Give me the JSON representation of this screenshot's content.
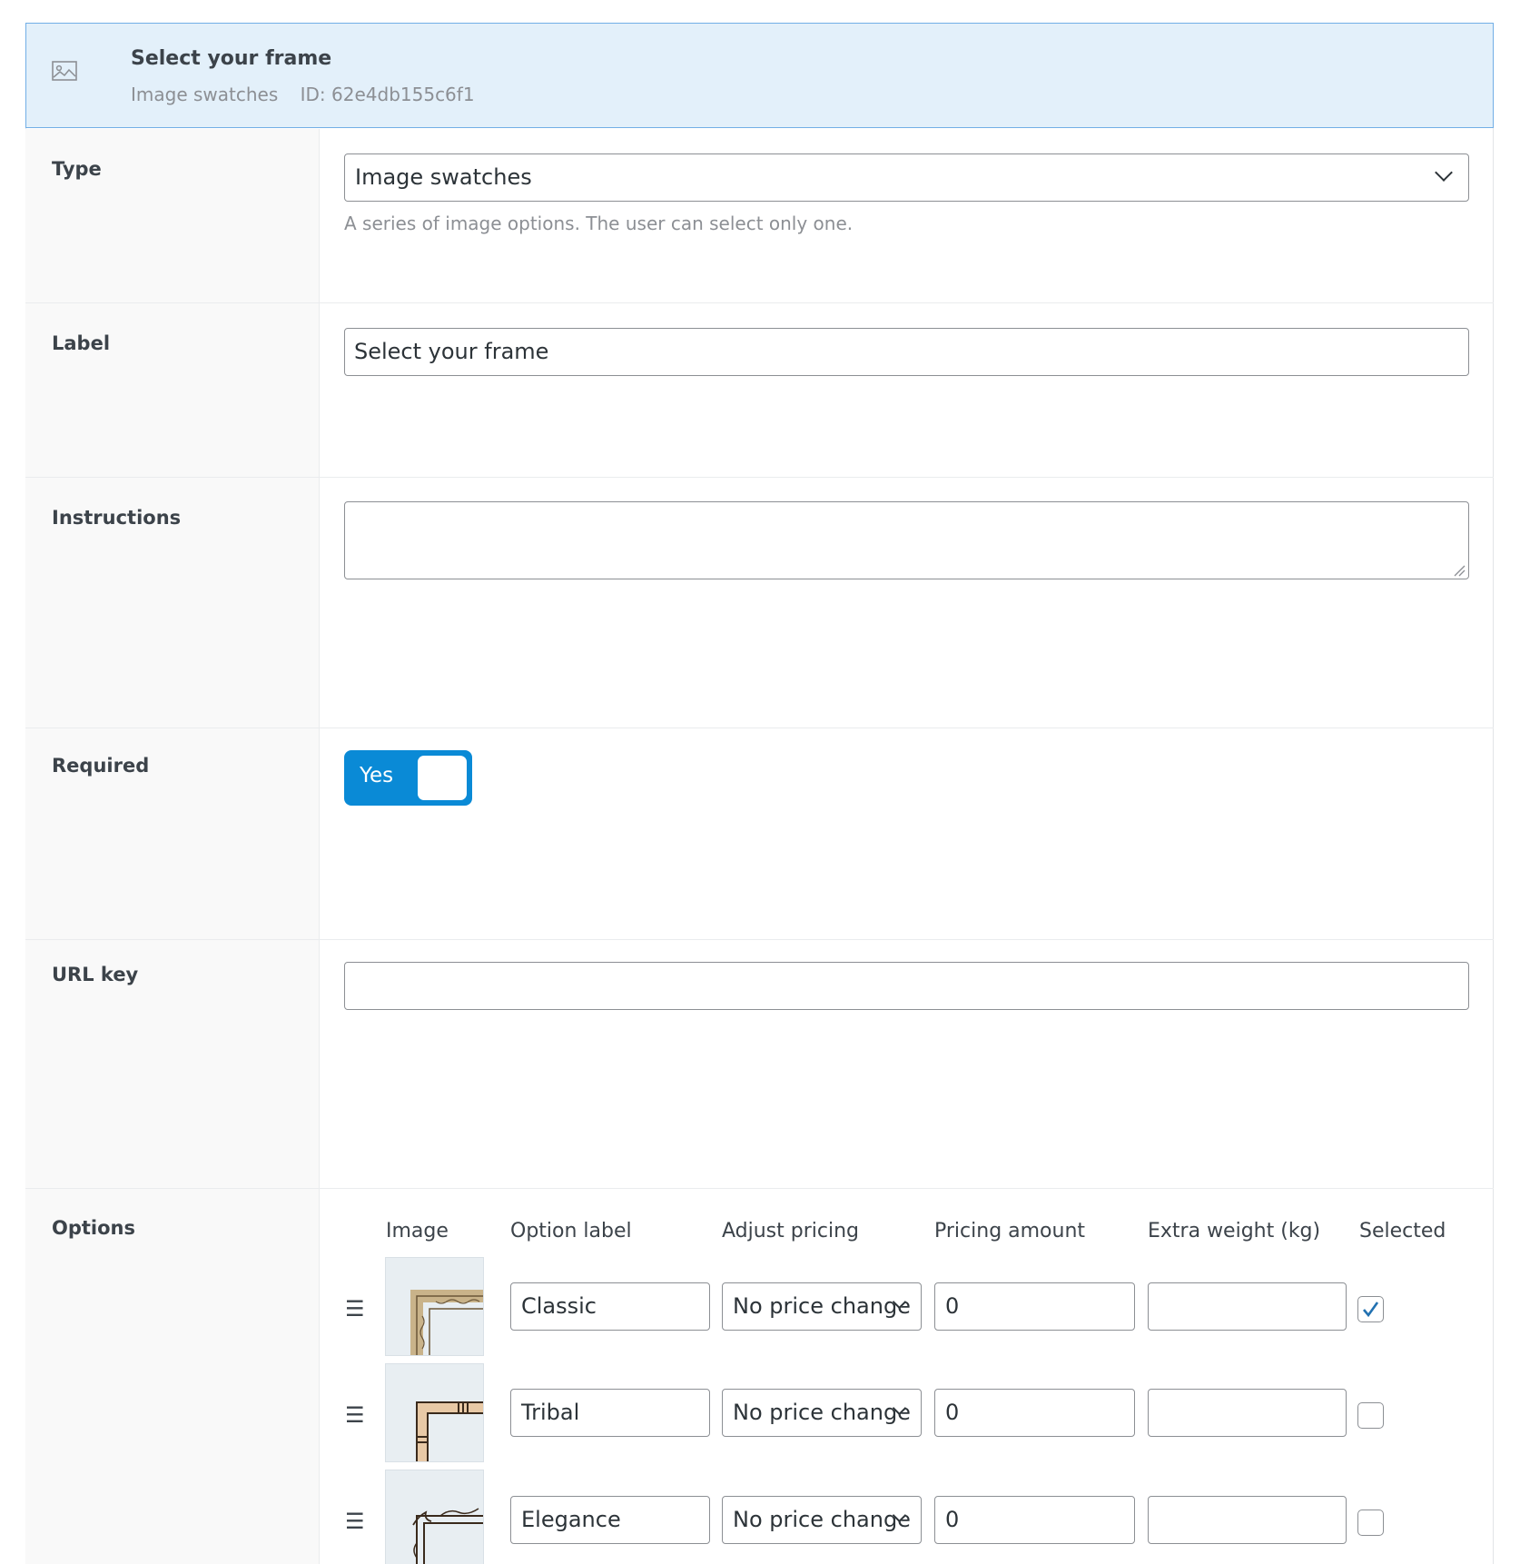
{
  "header": {
    "title": "Select your frame",
    "type_label": "Image swatches",
    "id_text": "ID: 62e4db155c6f1",
    "icon": "image-icon"
  },
  "fields": {
    "type": {
      "label": "Type",
      "value": "Image swatches",
      "hint": "A series of image options. The user can select only one."
    },
    "label": {
      "label": "Label",
      "value": "Select your frame"
    },
    "instructions": {
      "label": "Instructions",
      "value": ""
    },
    "required": {
      "label": "Required",
      "toggle_text": "Yes",
      "checked": true
    },
    "url_key": {
      "label": "URL key",
      "value": ""
    }
  },
  "options": {
    "label": "Options",
    "columns": [
      "Image",
      "Option label",
      "Adjust pricing",
      "Pricing amount",
      "Extra weight (kg)",
      "Selected"
    ],
    "rows": [
      {
        "label": "Classic",
        "pricing": "No price change",
        "amount": "0",
        "weight": "",
        "selected": true,
        "image": "classic-frame-thumbnail"
      },
      {
        "label": "Tribal",
        "pricing": "No price change",
        "amount": "0",
        "weight": "",
        "selected": false,
        "image": "tribal-frame-thumbnail"
      },
      {
        "label": "Elegance",
        "pricing": "No price change",
        "amount": "0",
        "weight": "",
        "selected": false,
        "image": "elegance-frame-thumbnail"
      }
    ]
  },
  "colors": {
    "header_bg": "#e3f0fa",
    "header_border": "#72aee6",
    "toggle_on": "#0a8ad6",
    "check_mark": "#2271b1"
  }
}
